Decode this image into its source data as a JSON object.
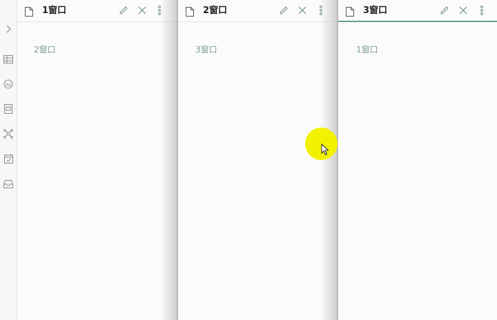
{
  "ribbon": {
    "icons": [
      "chevron-right-icon",
      "table-icon",
      "translate-icon",
      "card-icon",
      "graph-icon",
      "calendar-check-icon",
      "inbox-icon"
    ]
  },
  "panes": [
    {
      "title": "1窗口",
      "content": "2窗口",
      "active": false
    },
    {
      "title": "2窗口",
      "content": "3窗口",
      "active": false
    },
    {
      "title": "3窗口",
      "content": "1窗口",
      "active": true
    }
  ],
  "colors": {
    "accent": "#6a9e84",
    "link_text": "#7b9e8b",
    "cursor_highlight": "#f2f200"
  }
}
